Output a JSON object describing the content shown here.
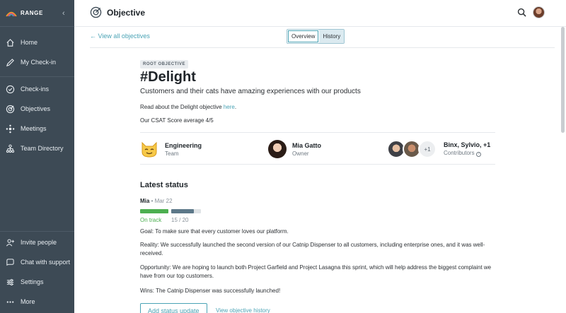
{
  "app": {
    "brand": "RANGE"
  },
  "sidebar": {
    "top_items": [
      {
        "label": "Home"
      },
      {
        "label": "My Check-in"
      }
    ],
    "mid_items": [
      {
        "label": "Check-ins"
      },
      {
        "label": "Objectives"
      },
      {
        "label": "Meetings"
      },
      {
        "label": "Team Directory"
      }
    ],
    "bottom_items": [
      {
        "label": "Invite people"
      },
      {
        "label": "Chat with support"
      },
      {
        "label": "Settings"
      },
      {
        "label": "More"
      }
    ]
  },
  "header": {
    "title": "Objective"
  },
  "subnav": {
    "back_link": "← View all objectives",
    "tabs": [
      {
        "label": "Overview"
      },
      {
        "label": "History"
      }
    ]
  },
  "objective": {
    "badge": "ROOT OBJECTIVE",
    "title": "#Delight",
    "subtitle": "Customers and their cats have amazing experiences with our products",
    "read_prefix": "Read about the Delight objective ",
    "read_link": "here",
    "read_suffix": ".",
    "csat": "Our CSAT Score average 4/5"
  },
  "people": {
    "team": {
      "name": "Engineering",
      "role": "Team"
    },
    "owner": {
      "name": "Mia Gatto",
      "role": "Owner"
    },
    "contributors": {
      "name": "Binx, Sylvio, +1",
      "role": "Contributors",
      "more_count": "+1"
    }
  },
  "status": {
    "heading": "Latest status",
    "author": "Mia",
    "date": "Mar 22",
    "state_label": "On track",
    "progress_label": "15 / 20",
    "progress_fraction": 0.75,
    "goal": "Goal: To make sure that every customer loves our platform.",
    "reality": "Reality: We successfully launched the second version of our Catnip Dispenser to all customers, including enterprise ones, and it was well-received.",
    "opportunity": "Opportunity: We are hoping to launch both Project Garfield and Project Lasagna this sprint, which will help address the biggest complaint we have from our top customers.",
    "wins": "Wins: The Catnip Dispenser was successfully launched!",
    "add_button": "Add status update",
    "history_link": "View objective history"
  },
  "colors": {
    "sidebar_bg": "#3d4a55",
    "accent": "#4aa3b5",
    "on_track": "#4caf50"
  }
}
